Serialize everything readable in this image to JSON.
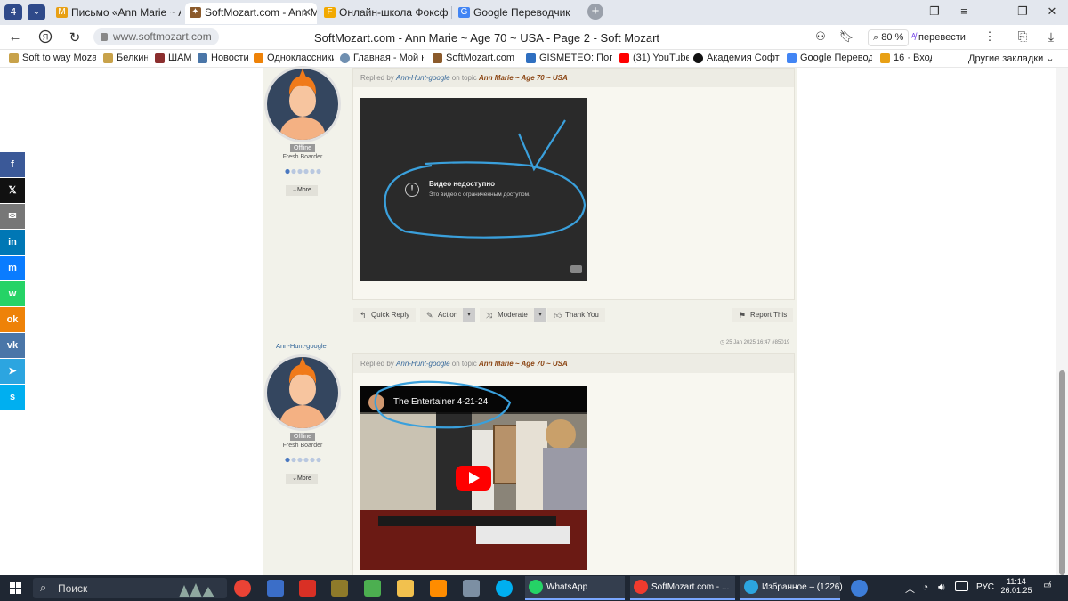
{
  "browser": {
    "tab_counter": "4",
    "tabs": [
      {
        "label": "Письмо «Ann Marie ~ Age",
        "active": false
      },
      {
        "label": "SoftMozart.com - Ann M",
        "active": true
      },
      {
        "label": "Онлайн-школа Фоксфорд",
        "active": false
      },
      {
        "label": "Google Переводчик",
        "active": false
      }
    ],
    "url": "www.softmozart.com",
    "page_title": "SoftMozart.com - Ann Marie ~ Age 70 ~ USA - Page 2 - Soft Mozart",
    "zoom": "80 %",
    "translate_label": "перевести"
  },
  "bookmarks": {
    "items": [
      "Soft to way Mozar",
      "Белкин",
      "ШАМ",
      "Новости",
      "Одноклассники",
      "Главная - Мой на",
      "SoftMozart.com -",
      "GISMETEO: Погод",
      "(31) YouTube",
      "Академия Софт М",
      "Google Переводч",
      "16 · Вход"
    ],
    "other": "Другие закладки"
  },
  "share_bar": {
    "items": [
      {
        "name": "facebook",
        "glyph": "f",
        "color": "#3b5998"
      },
      {
        "name": "x",
        "glyph": "𝕏",
        "color": "#111111"
      },
      {
        "name": "email",
        "glyph": "✉",
        "color": "#777777"
      },
      {
        "name": "linkedin",
        "glyph": "in",
        "color": "#0077b5"
      },
      {
        "name": "messenger",
        "glyph": "m",
        "color": "#0a7cff"
      },
      {
        "name": "whatsapp",
        "glyph": "w",
        "color": "#25d366"
      },
      {
        "name": "odnoklassniki",
        "glyph": "ok",
        "color": "#ee8208"
      },
      {
        "name": "vk",
        "glyph": "vk",
        "color": "#4a76a8"
      },
      {
        "name": "telegram",
        "glyph": "➤",
        "color": "#2ca5e0"
      },
      {
        "name": "skype",
        "glyph": "s",
        "color": "#00aff0"
      }
    ]
  },
  "post1": {
    "status": "Offline",
    "rank": "Fresh Boarder",
    "more_label": "More",
    "reply_prefix": "Replied by",
    "author": "Ann-Hunt-google",
    "on_topic": "on topic",
    "topic": "Ann Marie ~ Age 70 ~ USA",
    "video_title": "Видео недоступно",
    "video_subtitle": "Это видео с ограниченным доступом."
  },
  "actions": {
    "quick_reply": "Quick Reply",
    "action": "Action",
    "moderate": "Moderate",
    "thank_you": "Thank You",
    "report": "Report This"
  },
  "post2": {
    "username": "Ann-Hunt-google",
    "timestamp": "25 Jan 2025 16:47 #85019",
    "status": "Offline",
    "rank": "Fresh Boarder",
    "more_label": "More",
    "reply_prefix": "Replied by",
    "author": "Ann-Hunt-google",
    "on_topic": "on topic",
    "topic": "Ann Marie ~ Age 70 ~ USA",
    "video_title": "The Entertainer 4-21-24"
  },
  "taskbar": {
    "search_label": "Поиск",
    "apps": [
      {
        "label": "WhatsApp",
        "color": "#25d366"
      },
      {
        "label": "SoftMozart.com - ...",
        "color": "#f03b2e"
      },
      {
        "label": "Избранное – (1226)",
        "color": "#2ca5e0"
      }
    ],
    "lang": "РУС",
    "time": "11:14",
    "date": "26.01.25",
    "notif_count": "7"
  },
  "colors": {
    "annotation_blue": "#3aa0dc",
    "taskbar_bg": "#1f2733",
    "forum_bg": "#f2f2ea"
  }
}
